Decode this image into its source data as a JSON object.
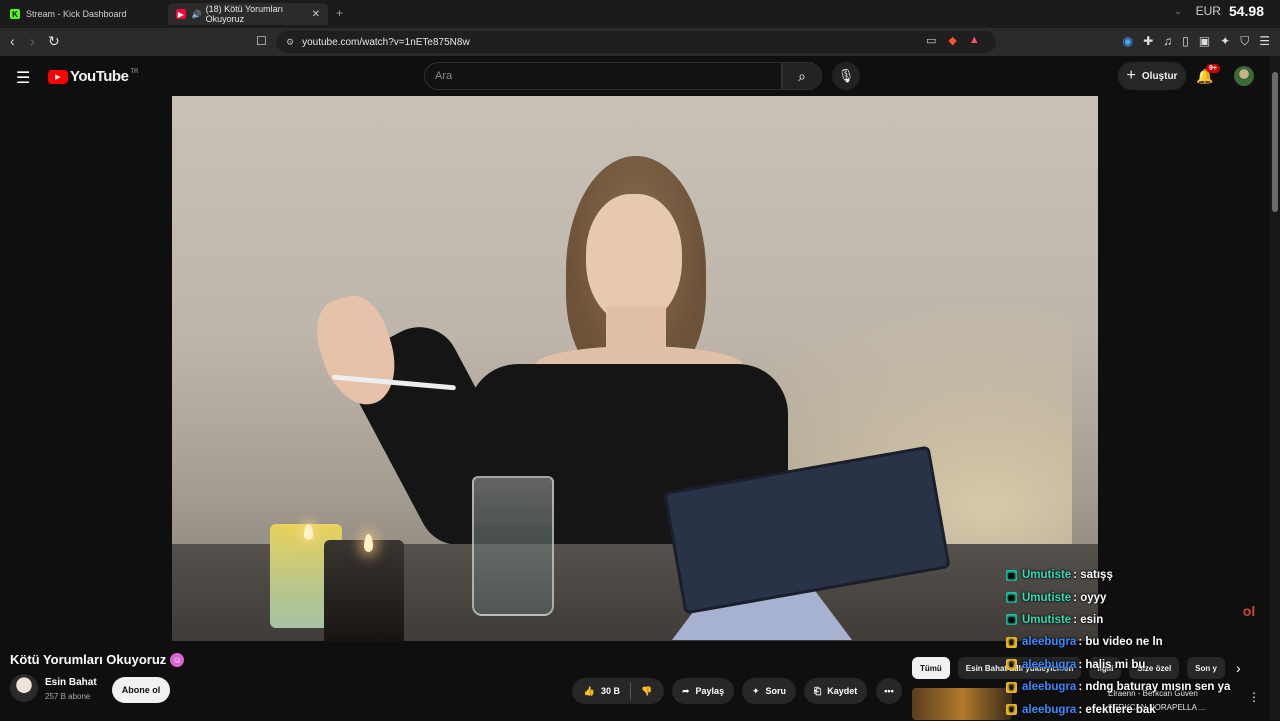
{
  "browser": {
    "tabs": [
      {
        "title": "Stream - Kick Dashboard"
      },
      {
        "title": "(18) Kötü Yorumları Okuyoruz"
      }
    ],
    "currency_label": "EUR",
    "currency_value": "54.98",
    "url": "youtube.com/watch?v=1nETe875N8w"
  },
  "youtube": {
    "logo_text": "YouTube",
    "region": "TR",
    "search_placeholder": "Ara",
    "create_label": "Oluştur",
    "notif_count": "9+"
  },
  "video": {
    "title": "Kötü Yorumları Okuyoruz",
    "channel_name": "Esin Bahat",
    "subscribers": "257 B abone",
    "subscribe_label": "Abone ol",
    "like_count": "30 B",
    "share_label": "Paylaş",
    "ask_label": "Soru",
    "save_label": "Kaydet"
  },
  "chips": [
    "Tümü",
    "Esin Bahat adlı yükleyiciden",
    "İlgili",
    "Size özel",
    "Son y"
  ],
  "recommendation": {
    "title": "Elraenn - Berkcan Güven",
    "channel": "BERKCAN NORAPELLA ..."
  },
  "chat": [
    {
      "user": "Umutiste",
      "message": ": satışş",
      "color": "#2fe0b8",
      "badge": "green"
    },
    {
      "user": "Umutiste",
      "message": ": oyyy",
      "color": "#2fe0b8",
      "badge": "green"
    },
    {
      "user": "Umutiste",
      "message": ": esin",
      "color": "#2fe0b8",
      "badge": "green"
    },
    {
      "user": "aleebugra",
      "message": ": bu video ne ln",
      "color": "#3b8cff",
      "badge": "gold"
    },
    {
      "user": "aleebugra",
      "message": ": halis mi bu",
      "color": "#3b8cff",
      "badge": "gold"
    },
    {
      "user": "aleebugra",
      "message": ": ndng baturay mısın sen ya",
      "color": "#3b8cff",
      "badge": "gold"
    },
    {
      "user": "aleebugra",
      "message": ": efektlere bak",
      "color": "#3b8cff",
      "badge": "gold"
    }
  ],
  "watermark_text": "ol"
}
